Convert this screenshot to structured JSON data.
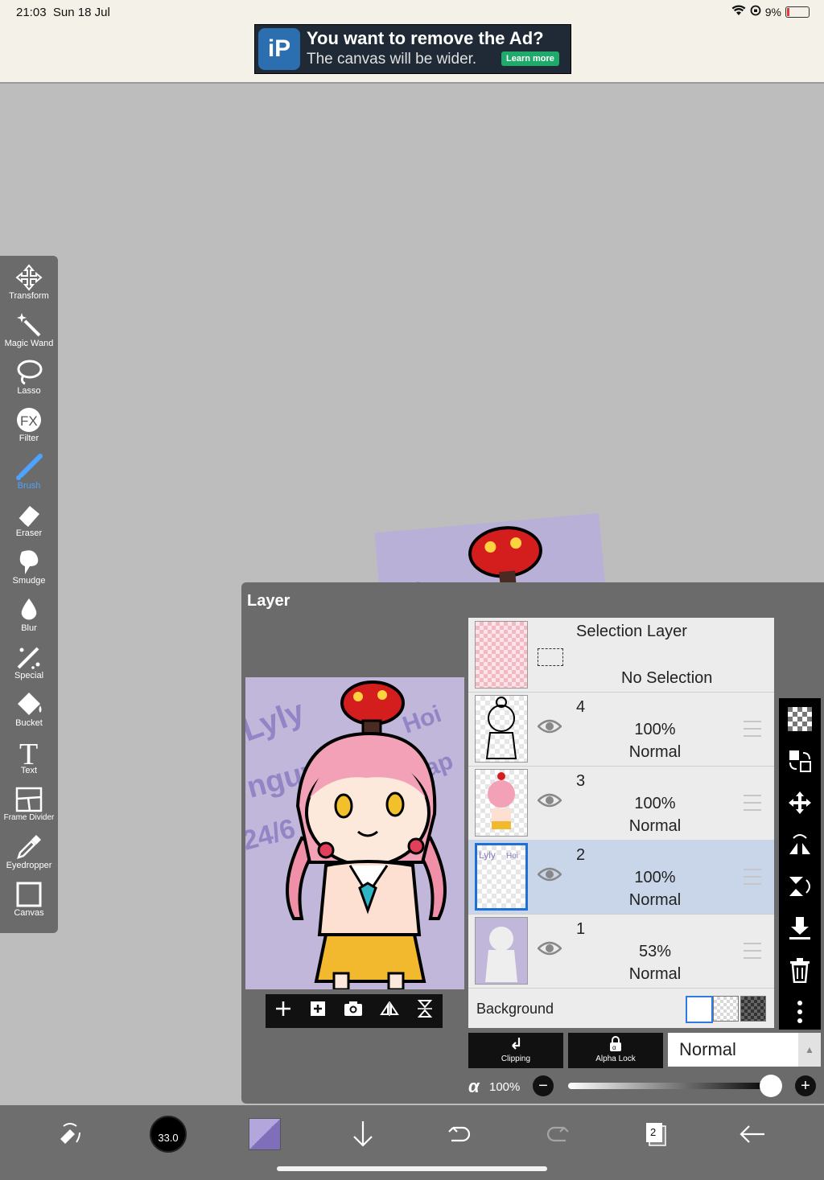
{
  "status": {
    "time": "21:03",
    "date": "Sun 18 Jul",
    "battery": "9%"
  },
  "ad": {
    "title": "You want to remove the Ad?",
    "subtitle": "The canvas will be wider.",
    "button": "Learn more"
  },
  "toolbar": {
    "items": [
      {
        "label": "Transform"
      },
      {
        "label": "Magic Wand"
      },
      {
        "label": "Lasso"
      },
      {
        "label": "Filter"
      },
      {
        "label": "Brush"
      },
      {
        "label": "Eraser"
      },
      {
        "label": "Smudge"
      },
      {
        "label": "Blur"
      },
      {
        "label": "Special"
      },
      {
        "label": "Bucket"
      },
      {
        "label": "Text"
      },
      {
        "label": "Frame Divider"
      },
      {
        "label": "Eyedropper"
      },
      {
        "label": "Canvas"
      }
    ]
  },
  "layer_panel": {
    "title": "Layer",
    "selection": {
      "title": "Selection Layer",
      "subtitle": "No Selection"
    },
    "layers": [
      {
        "num": "4",
        "opacity": "100%",
        "mode": "Normal"
      },
      {
        "num": "3",
        "opacity": "100%",
        "mode": "Normal"
      },
      {
        "num": "2",
        "opacity": "100%",
        "mode": "Normal"
      },
      {
        "num": "1",
        "opacity": "53%",
        "mode": "Normal"
      }
    ],
    "background_label": "Background",
    "clipping": "Clipping",
    "alpha_lock": "Alpha Lock",
    "blend_mode": "Normal",
    "alpha_symbol": "α",
    "alpha_value": "100%",
    "alpha_fraction": 1.0
  },
  "bottom": {
    "brush_size": "33.0",
    "layer_count": "2"
  },
  "colors": {
    "accent": "#4da3ff",
    "selected_row": "#c9d6ea",
    "panel": "#6b6b6b"
  }
}
